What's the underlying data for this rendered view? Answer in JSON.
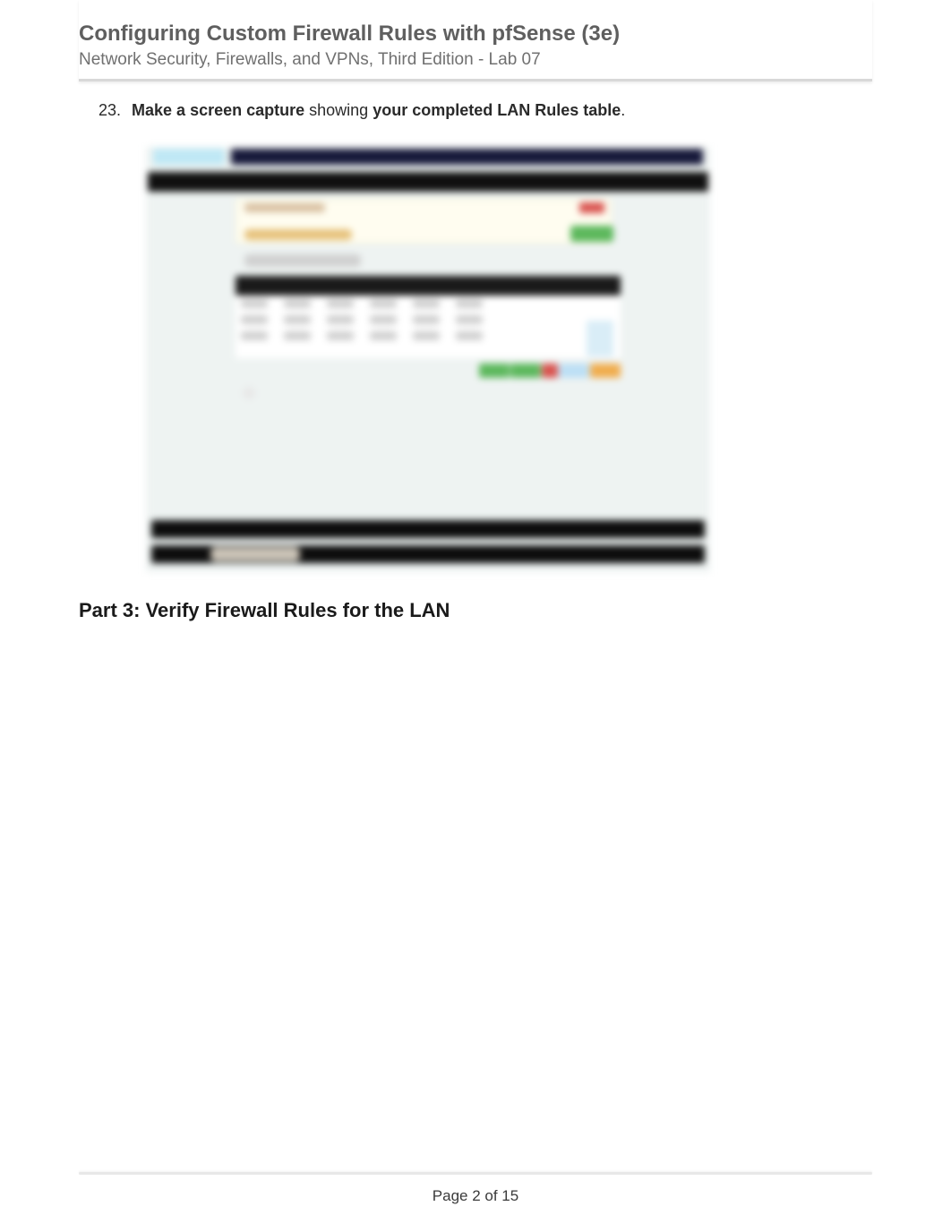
{
  "header": {
    "title": "Configuring Custom Firewall Rules with pfSense (3e)",
    "subtitle": "Network Security, Firewalls, and VPNs, Third Edition - Lab 07"
  },
  "instruction": {
    "number": "23.",
    "bold_prefix": "Make a screen capture",
    "middle": " showing ",
    "bold_suffix": "your completed LAN Rules table",
    "period": "."
  },
  "section_heading": "Part 3: Verify Firewall Rules for the LAN",
  "footer": {
    "page_label": "Page 2 of 15"
  }
}
